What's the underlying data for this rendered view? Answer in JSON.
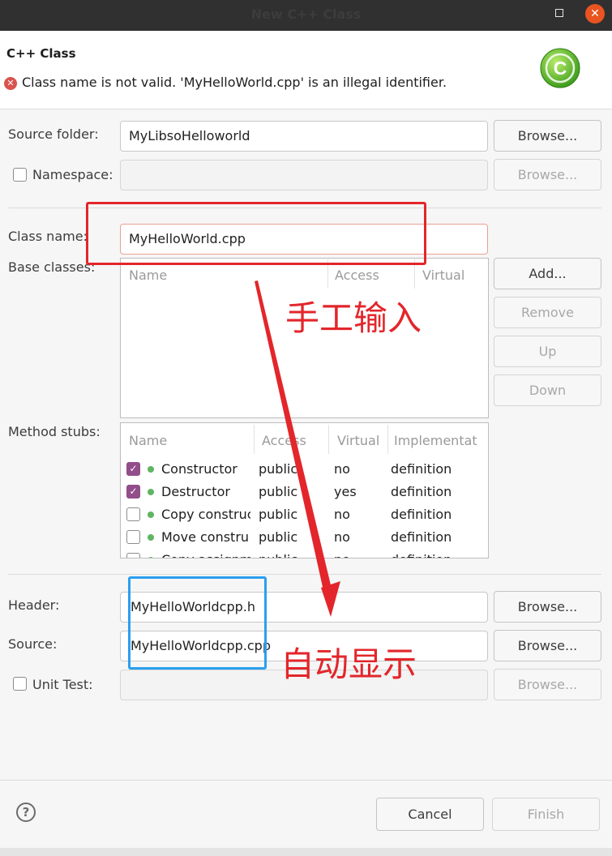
{
  "window": {
    "title": "New C++ Class",
    "maximize_icon": "maximize-icon",
    "close_icon": "close-icon",
    "close_glyph": "✕"
  },
  "header": {
    "heading": "C++ Class",
    "error_icon": "error-icon",
    "error_glyph": "✕",
    "error_message": "Class name is not valid. 'MyHelloWorld.cpp' is an illegal identifier.",
    "logo_letter": "C"
  },
  "form": {
    "source_folder": {
      "label": "Source folder:",
      "value": "MyLibsoHelloworld",
      "browse": "Browse..."
    },
    "namespace": {
      "label": "Namespace:",
      "checked": false,
      "value": "",
      "browse": "Browse..."
    },
    "class_name": {
      "label": "Class name:",
      "value": "MyHelloWorld.cpp"
    },
    "base_classes": {
      "label": "Base classes:",
      "columns": [
        "Name",
        "Access",
        "Virtual"
      ],
      "buttons": {
        "add": "Add...",
        "remove": "Remove",
        "up": "Up",
        "down": "Down"
      }
    },
    "method_stubs": {
      "label": "Method stubs:",
      "columns": [
        "Name",
        "Access",
        "Virtual",
        "Implementat"
      ],
      "rows": [
        {
          "checked": true,
          "name": "Constructor",
          "access": "public",
          "virtual": "no",
          "impl": "definition"
        },
        {
          "checked": true,
          "name": "Destructor",
          "access": "public",
          "virtual": "yes",
          "impl": "definition"
        },
        {
          "checked": false,
          "name": "Copy construc",
          "access": "public",
          "virtual": "no",
          "impl": "definition"
        },
        {
          "checked": false,
          "name": "Move constru",
          "access": "public",
          "virtual": "no",
          "impl": "definition"
        },
        {
          "checked": false,
          "name": "Copy assignm",
          "access": "public",
          "virtual": "no",
          "impl": "definition"
        }
      ]
    },
    "header_file": {
      "label": "Header:",
      "value": "MyHelloWorldcpp.h",
      "browse": "Browse..."
    },
    "source_file": {
      "label": "Source:",
      "value": "MyHelloWorldcpp.cpp",
      "browse": "Browse..."
    },
    "unit_test": {
      "label": "Unit Test:",
      "checked": false,
      "value": "",
      "browse": "Browse..."
    }
  },
  "footer": {
    "help": "?",
    "cancel": "Cancel",
    "finish": "Finish"
  },
  "annotations": {
    "manual_input": "手工输入",
    "auto_display": "自动显示"
  },
  "colors": {
    "annotation_red": "#e3262b",
    "annotation_blue": "#2a9ff0",
    "checkbox_purple": "#924d8b",
    "close_orange": "#e95420"
  }
}
